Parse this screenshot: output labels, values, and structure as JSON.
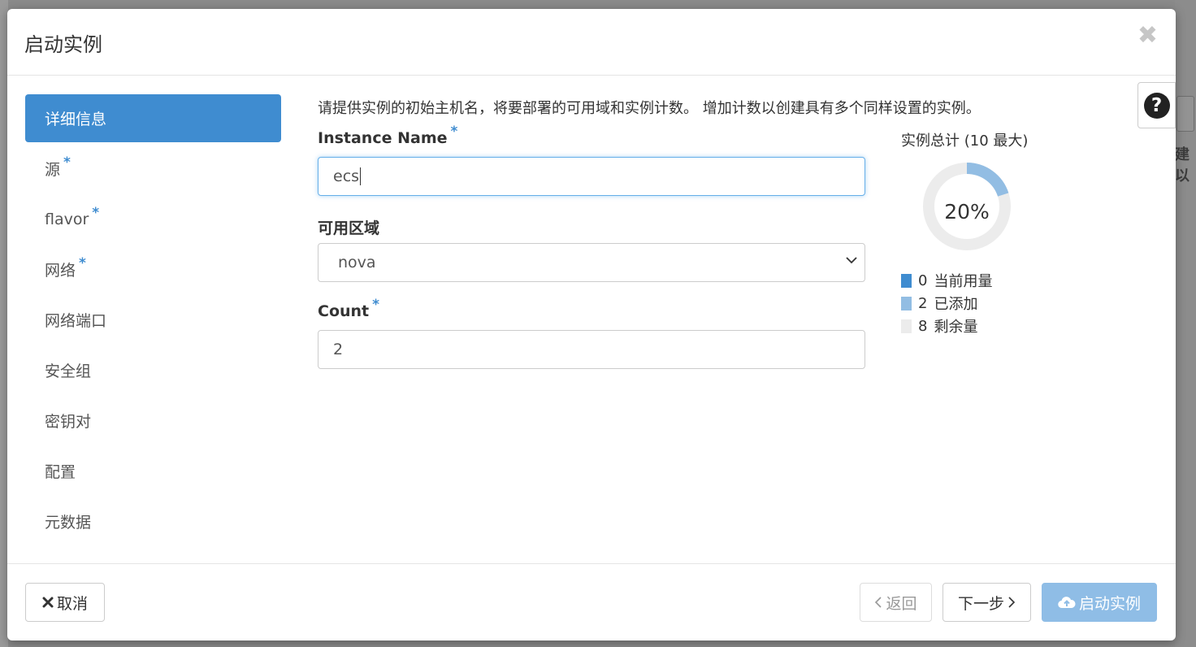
{
  "dialog": {
    "title": "启动实例",
    "close_glyph": "✖",
    "help_glyph": "?"
  },
  "background": {
    "partial_text": "建以"
  },
  "nav": {
    "items": [
      {
        "label": "详细信息",
        "required": false,
        "active": true
      },
      {
        "label": "源",
        "required": true,
        "active": false
      },
      {
        "label": "flavor",
        "required": true,
        "active": false
      },
      {
        "label": "网络",
        "required": true,
        "active": false
      },
      {
        "label": "网络端口",
        "required": false,
        "active": false
      },
      {
        "label": "安全组",
        "required": false,
        "active": false
      },
      {
        "label": "密钥对",
        "required": false,
        "active": false
      },
      {
        "label": "配置",
        "required": false,
        "active": false
      },
      {
        "label": "元数据",
        "required": false,
        "active": false
      }
    ],
    "required_mark": "*"
  },
  "form": {
    "description": "请提供实例的初始主机名，将要部署的可用域和实例计数。 增加计数以创建具有多个同样设置的实例。",
    "instance_name": {
      "label": "Instance Name",
      "value": "ecs"
    },
    "zone": {
      "label": "可用区域",
      "value": "nova"
    },
    "count": {
      "label": "Count",
      "value": "2"
    }
  },
  "usage": {
    "title": "实例总计 (10 最大)",
    "percent_label": "20%",
    "max": 10,
    "legend": [
      {
        "value": "0",
        "label": "当前用量",
        "color": "#3f8cd0"
      },
      {
        "value": "2",
        "label": "已添加",
        "color": "#92bde3"
      },
      {
        "value": "8",
        "label": "剩余量",
        "color": "#ececec"
      }
    ]
  },
  "footer": {
    "cancel_label": "取消",
    "back_label": "返回",
    "next_label": "下一步",
    "launch_label": "启动实例"
  },
  "colors": {
    "accent": "#3f8cd0",
    "launch_button": "#8fbde6"
  }
}
